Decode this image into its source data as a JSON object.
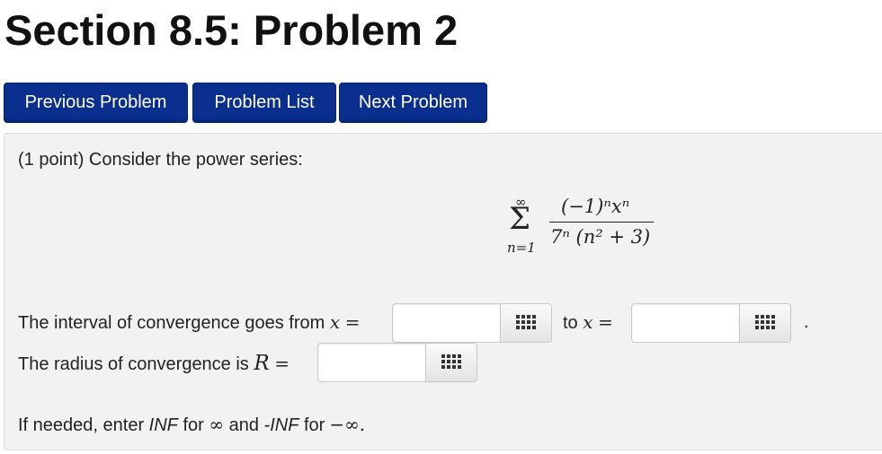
{
  "page": {
    "title": "Section 8.5: Problem 2"
  },
  "nav": {
    "previous": "Previous Problem",
    "list": "Problem List",
    "next": "Next Problem"
  },
  "problem": {
    "intro": "(1 point) Consider the power series:",
    "formula": {
      "sum_upper": "∞",
      "sum_symbol": "Σ",
      "sum_lower": "n=1",
      "numerator": "(−1)ⁿxⁿ",
      "denominator": "7ⁿ (n² + 3)"
    },
    "interval_prefix": "The interval of convergence goes from",
    "var_x": "x",
    "equals": "=",
    "to_label": "to",
    "period": ".",
    "radius_prefix": "The radius of convergence is",
    "var_R": "R",
    "hint": {
      "pre": "If needed, enter",
      "inf": "INF",
      "mid1": "for",
      "inf_sym": "∞",
      "and": "and",
      "neg_inf": "-INF",
      "mid2": "for",
      "neg_inf_sym": "−∞."
    }
  },
  "inputs": {
    "interval_from": {
      "value": ""
    },
    "interval_to": {
      "value": ""
    },
    "radius": {
      "value": ""
    }
  },
  "icons": {
    "palette": "equation-palette-icon"
  },
  "colors": {
    "button_bg": "#0b2f8f",
    "box_bg": "#f2f2f2"
  }
}
